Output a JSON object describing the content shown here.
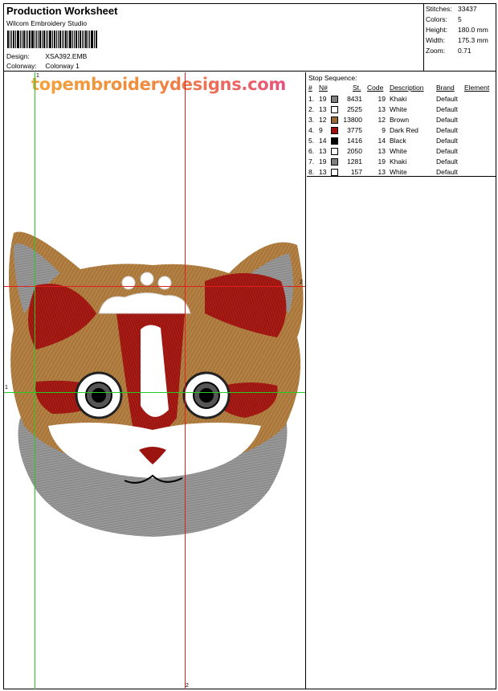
{
  "header": {
    "title": "Production Worksheet",
    "software": "Wilcom  Embroidery Studio",
    "design_label": "Design:",
    "design_value": "XSA392.EMB",
    "colorway_label": "Colorway:",
    "colorway_value": "Colorway 1"
  },
  "stats": {
    "stitches_label": "Stitches:",
    "stitches_value": "33437",
    "colors_label": "Colors:",
    "colors_value": "5",
    "height_label": "Height:",
    "height_value": "180.0 mm",
    "width_label": "Width:",
    "width_value": "175.3 mm",
    "zoom_label": "Zoom:",
    "zoom_value": "0.71"
  },
  "design": {
    "watermark": "topembroiderydesigns.com",
    "axis_labels": {
      "v_green": "1",
      "v_red": "2",
      "h_red": "2",
      "h_green": "1"
    },
    "line_colors": {
      "green": "#22cc22",
      "red": "#e02020"
    }
  },
  "stop_sequence": {
    "title": "Stop Sequence:",
    "columns": {
      "num": "#",
      "needle": "N#",
      "st": "St.",
      "code": "Code",
      "description": "Description",
      "brand": "Brand",
      "element": "Element"
    },
    "rows": [
      {
        "num": "1.",
        "needle": "19",
        "color": "#808080",
        "st": "8431",
        "code": "19",
        "description": "Khaki",
        "brand": "Default"
      },
      {
        "num": "2.",
        "needle": "13",
        "color": "#ffffff",
        "st": "2525",
        "code": "13",
        "description": "White",
        "brand": "Default"
      },
      {
        "num": "3.",
        "needle": "12",
        "color": "#9a6a36",
        "st": "13800",
        "code": "12",
        "description": "Brown",
        "brand": "Default"
      },
      {
        "num": "4.",
        "needle": "9",
        "color": "#a01010",
        "st": "3775",
        "code": "9",
        "description": "Dark Red",
        "brand": "Default"
      },
      {
        "num": "5.",
        "needle": "14",
        "color": "#000000",
        "st": "1416",
        "code": "14",
        "description": "Black",
        "brand": "Default"
      },
      {
        "num": "6.",
        "needle": "13",
        "color": "#ffffff",
        "st": "2050",
        "code": "13",
        "description": "White",
        "brand": "Default"
      },
      {
        "num": "7.",
        "needle": "19",
        "color": "#808080",
        "st": "1281",
        "code": "19",
        "description": "Khaki",
        "brand": "Default"
      },
      {
        "num": "8.",
        "needle": "13",
        "color": "#ffffff",
        "st": "157",
        "code": "13",
        "description": "White",
        "brand": "Default"
      }
    ]
  }
}
